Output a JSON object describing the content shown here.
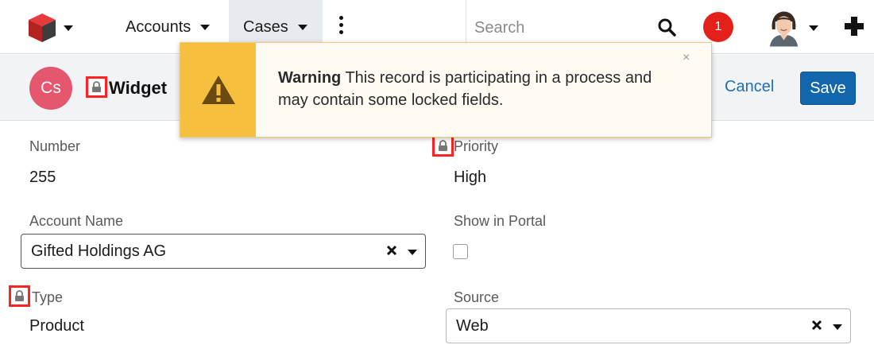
{
  "nav": {
    "tabs": [
      {
        "label": "Accounts"
      },
      {
        "label": "Cases"
      }
    ],
    "search": {
      "placeholder": "Search"
    },
    "notifications_count": "1"
  },
  "record": {
    "avatar_initials": "Cs",
    "name": "Widget",
    "cancel_label": "Cancel",
    "save_label": "Save"
  },
  "alert": {
    "title": "Warning",
    "message": "This record is participating in a process and may contain some locked fields.",
    "close_symbol": "×"
  },
  "fields": {
    "number": {
      "label": "Number",
      "value": "255"
    },
    "priority": {
      "label": "Priority",
      "value": "High"
    },
    "account_name": {
      "label": "Account Name",
      "value": "Gifted Holdings AG"
    },
    "show_in_portal": {
      "label": "Show in Portal",
      "checked": false
    },
    "type": {
      "label": "Type",
      "value": "Product"
    },
    "source": {
      "label": "Source",
      "value": "Web"
    }
  },
  "colors": {
    "brand_blue": "#1266ab",
    "alert_yellow": "#f7bf3e",
    "notification_red": "#e3201a",
    "avatar_pink": "#e5576f",
    "lock_highlight_red": "#ff2222"
  },
  "icons": [
    "logo-cube-icon",
    "caret-down-icon",
    "kebab-menu-icon",
    "search-icon",
    "user-avatar-icon",
    "plus-icon",
    "lock-icon",
    "warning-icon",
    "close-icon",
    "clear-x-icon"
  ]
}
